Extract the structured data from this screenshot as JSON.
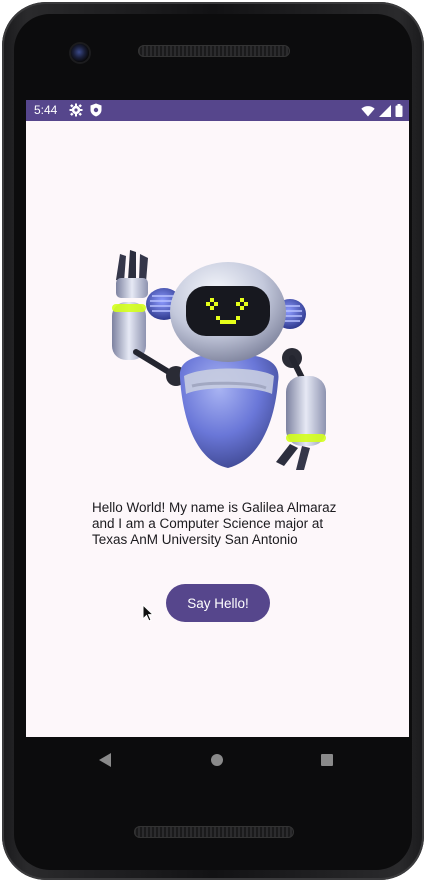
{
  "status_bar": {
    "time": "5:44",
    "icons": [
      "gear-icon",
      "shield-icon",
      "wifi-icon",
      "signal-icon",
      "battery-icon"
    ],
    "background": "#56468c"
  },
  "main": {
    "intro_text": "Hello World! My name is Galilea Almaraz and I am a Computer Science major at Texas AnM University San Antonio",
    "hello_button_label": "Say Hello!",
    "accent": "#56468c",
    "image": "waving-robot"
  },
  "nav_bar": {
    "icons": [
      "back-icon",
      "home-icon",
      "recents-icon"
    ]
  }
}
